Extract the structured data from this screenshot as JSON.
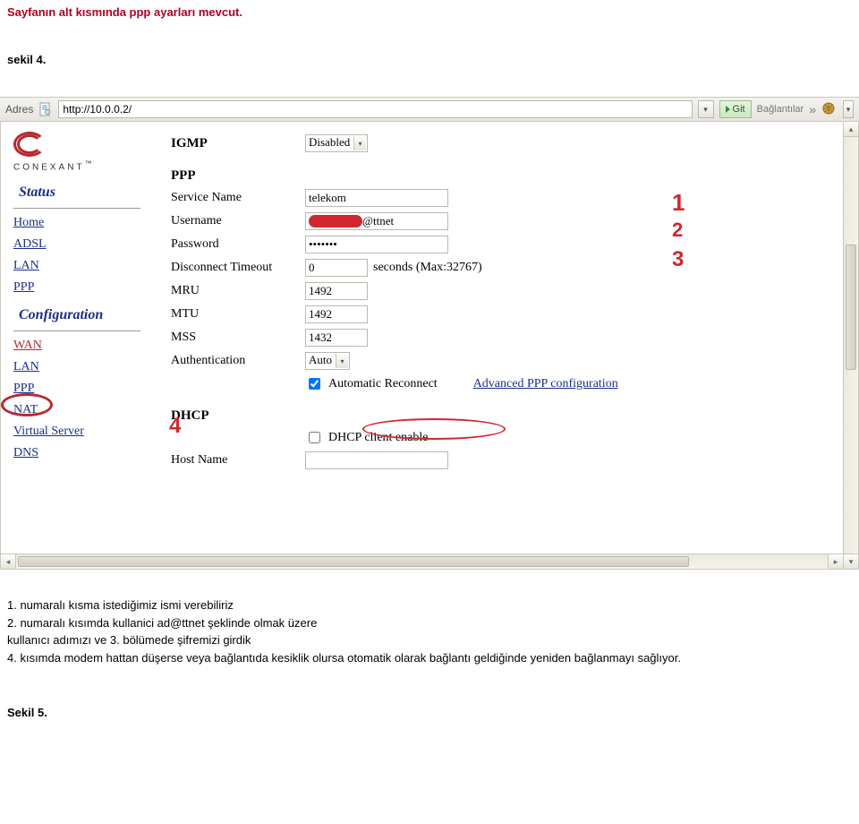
{
  "doc": {
    "header_note": "Sayfanın alt kısmında ppp ayarları mevcut.",
    "fig_label_top": "sekil 4.",
    "after_line1": "1. numaralı kısma istediğimiz ismi verebiliriz",
    "after_line2_a": "2. numaralı kısımda kullanici ad@ttnet şeklinde olmak üzere",
    "after_line2_b": "kullanıcı adımızı ve 3. bölümede şifremizi girdik",
    "after_line3": "4. kısımda modem hattan düşerse veya bağlantıda kesiklik olursa otomatik olarak bağlantı geldiğinde yeniden bağlanmayı sağlıyor.",
    "fig_label_bottom": "Sekil 5."
  },
  "browser": {
    "address_label": "Adres",
    "url": "http://10.0.0.2/",
    "go_label": "Git",
    "links_label": "Bağlantılar"
  },
  "sidebar": {
    "brand": "CONEXANT",
    "section_status": "Status",
    "section_config": "Configuration",
    "status_items": [
      "Home",
      "ADSL",
      "LAN",
      "PPP"
    ],
    "config_items": [
      "WAN",
      "LAN",
      "PPP",
      "NAT",
      "Virtual Server",
      "DNS"
    ]
  },
  "form": {
    "igmp_label": "IGMP",
    "igmp_value": "Disabled",
    "ppp_header": "PPP",
    "service_name_label": "Service Name",
    "service_name_value": "telekom",
    "username_label": "Username",
    "username_suffix": "@ttnet",
    "password_label": "Password",
    "password_value": "•••••••",
    "disconnect_label": "Disconnect Timeout",
    "disconnect_value": "0",
    "disconnect_suffix": "seconds (Max:32767)",
    "mru_label": "MRU",
    "mru_value": "1492",
    "mtu_label": "MTU",
    "mtu_value": "1492",
    "mss_label": "MSS",
    "mss_value": "1432",
    "auth_label": "Authentication",
    "auth_value": "Auto",
    "auto_reconnect_label": "Automatic Reconnect",
    "adv_ppp_label": "Advanced PPP configuration",
    "dhcp_header": "DHCP",
    "dhcp_client_label": "DHCP client enable",
    "host_name_label": "Host Name",
    "host_name_value": ""
  },
  "annotations": {
    "n1": "1",
    "n2": "2",
    "n3": "3",
    "n4": "4"
  }
}
